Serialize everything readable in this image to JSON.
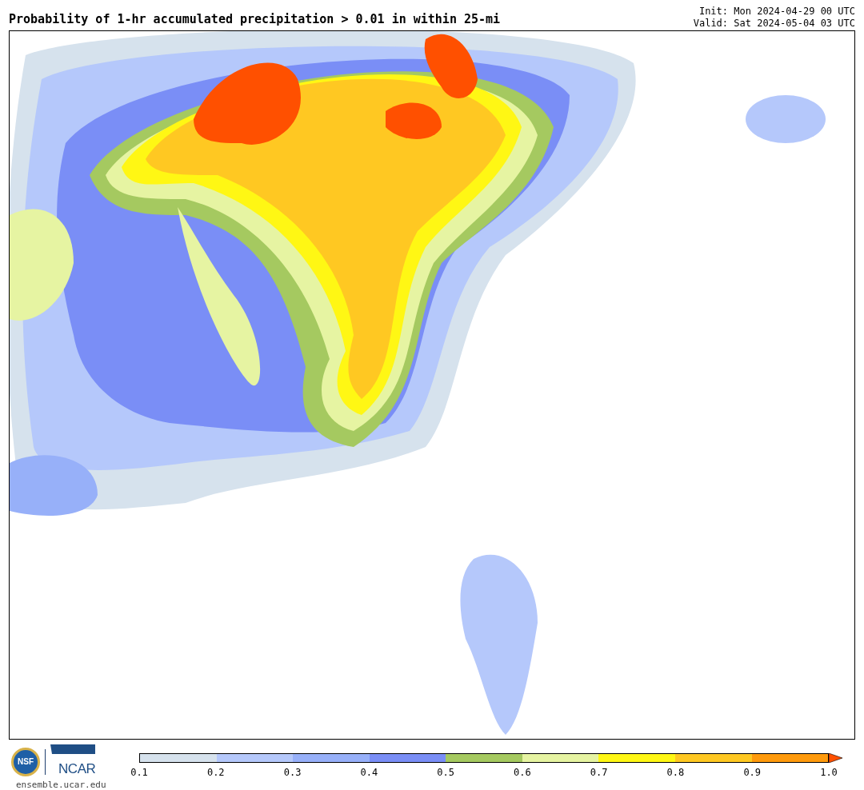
{
  "title": "Probability of 1-hr accumulated precipitation > 0.01 in within 25-mi",
  "init": "Init: Mon 2024-04-29 00 UTC",
  "valid": "Valid: Sat 2024-05-04 03 UTC",
  "logos": {
    "nsf": "NSF",
    "ncar": "NCAR",
    "url": "ensemble.ucar.edu"
  },
  "colorbar": {
    "segments": [
      {
        "color": "#d6e2ed"
      },
      {
        "color": "#b5c8fb"
      },
      {
        "color": "#97b0f9"
      },
      {
        "color": "#7a8ef6"
      },
      {
        "color": "#a5c960"
      },
      {
        "color": "#e6f4a2"
      },
      {
        "color": "#fff714"
      },
      {
        "color": "#ffc822"
      },
      {
        "color": "#ff9a0c"
      }
    ],
    "arrow": {
      "color": "#ff5000"
    },
    "ticks": [
      "0.1",
      "0.2",
      "0.3",
      "0.4",
      "0.5",
      "0.6",
      "0.7",
      "0.8",
      "0.9",
      "1.0"
    ]
  }
}
